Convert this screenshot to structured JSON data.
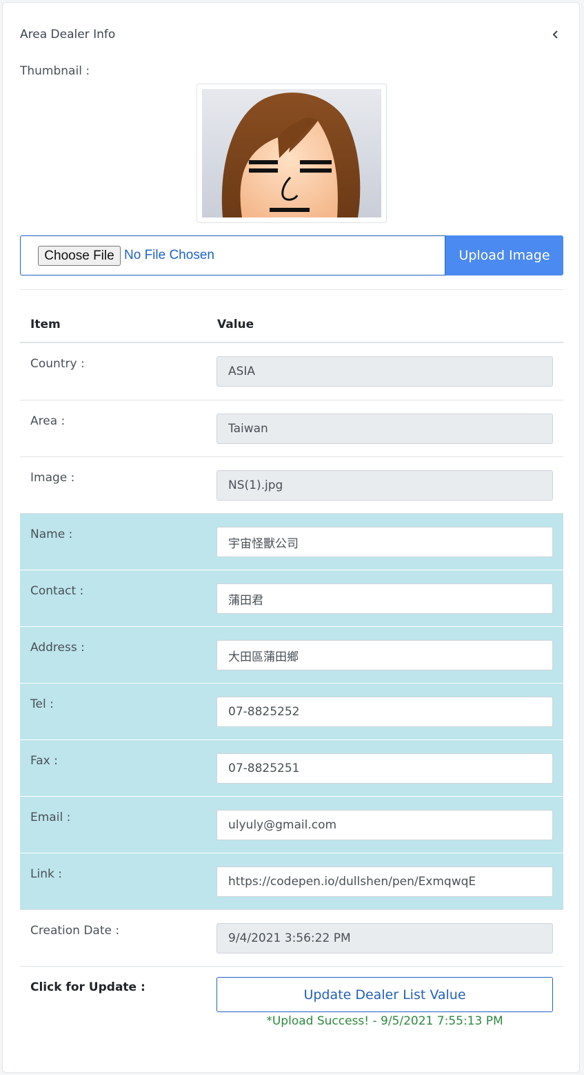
{
  "card": {
    "title": "Area Dealer Info",
    "collapse_icon": "chevron-left-icon"
  },
  "thumbnail": {
    "label": "Thumbnail :",
    "image_desc": "cartoon avatar face"
  },
  "upload": {
    "choose_label": "Choose File",
    "no_file_text": "No File Chosen",
    "upload_label": "Upload Image"
  },
  "table": {
    "headers": {
      "item": "Item",
      "value": "Value"
    },
    "rows": [
      {
        "label": "Country :",
        "value": "ASIA",
        "readonly": true
      },
      {
        "label": "Area :",
        "value": "Taiwan",
        "readonly": true
      },
      {
        "label": "Image :",
        "value": "NS(1).jpg",
        "readonly": true
      },
      {
        "label": "Name :",
        "value": "宇宙怪獸公司",
        "readonly": false
      },
      {
        "label": "Contact :",
        "value": "蒲田君",
        "readonly": false
      },
      {
        "label": "Address :",
        "value": "大田區蒲田鄉",
        "readonly": false
      },
      {
        "label": "Tel :",
        "value": "07-8825252",
        "readonly": false
      },
      {
        "label": "Fax :",
        "value": "07-8825251",
        "readonly": false
      },
      {
        "label": "Email :",
        "value": "ulyuly@gmail.com",
        "readonly": false
      },
      {
        "label": "Link :",
        "value": "https://codepen.io/dullshen/pen/ExmqwqE",
        "readonly": false
      },
      {
        "label": "Creation Date :",
        "value": "9/4/2021 3:56:22 PM",
        "readonly": true
      }
    ],
    "update": {
      "label": "Click for Update :",
      "button": "Update Dealer List Value",
      "status": "*Upload Success! - 9/5/2021 7:55:13 PM"
    }
  },
  "colors": {
    "accent": "#4b8af0",
    "info_row": "#bee5eb",
    "success": "#2c8a3e",
    "readonly_bg": "#e9ecef"
  }
}
